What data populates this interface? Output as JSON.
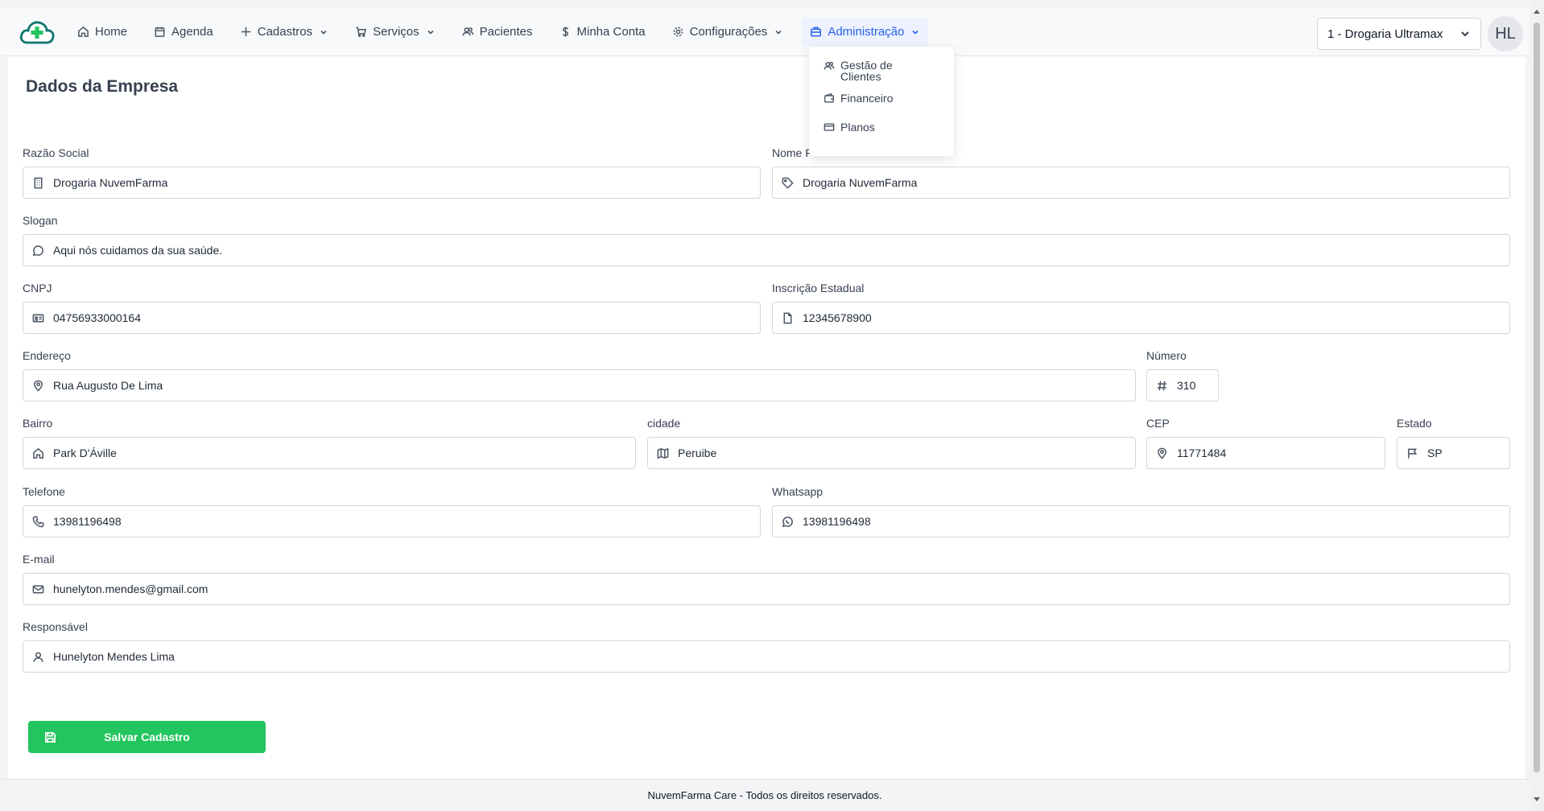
{
  "nav": {
    "home": "Home",
    "agenda": "Agenda",
    "cadastros": "Cadastros",
    "servicos": "Serviços",
    "pacientes": "Pacientes",
    "minha_conta": "Minha Conta",
    "configuracoes": "Configurações",
    "administracao": "Administração"
  },
  "admin_menu": {
    "gestao_clientes": "Gestão de Clientes",
    "financeiro": "Financeiro",
    "planos": "Planos"
  },
  "store_select": {
    "value": "1 - Drogaria Ultramax"
  },
  "avatar": {
    "initials": "HL"
  },
  "colors": {
    "primary": "#2563eb",
    "success": "#22c55e",
    "brand": "#0f766e"
  },
  "page": {
    "title": "Dados da Empresa"
  },
  "form": {
    "razao_social": {
      "label": "Razão Social",
      "value": "Drogaria NuvemFarma"
    },
    "nome_fantasia": {
      "label": "Nome F",
      "value": "Drogaria NuvemFarma"
    },
    "slogan": {
      "label": "Slogan",
      "value": "Aqui nós cuidamos da sua saúde."
    },
    "cnpj": {
      "label": "CNPJ",
      "value": "04756933000164"
    },
    "inscricao_estadual": {
      "label": "Inscrição Estadual",
      "value": "12345678900"
    },
    "endereco": {
      "label": "Endereço",
      "value": "Rua Augusto De Lima"
    },
    "numero": {
      "label": "Número",
      "value": "310"
    },
    "bairro": {
      "label": "Bairro",
      "value": "Park D'Áville"
    },
    "cidade": {
      "label": "cidade",
      "value": "Peruibe"
    },
    "cep": {
      "label": "CEP",
      "value": "11771484"
    },
    "estado": {
      "label": "Estado",
      "value": "SP"
    },
    "telefone": {
      "label": "Telefone",
      "value": "13981196498"
    },
    "whatsapp": {
      "label": "Whatsapp",
      "value": "13981196498"
    },
    "email": {
      "label": "E-mail",
      "value": "hunelyton.mendes@gmail.com"
    },
    "responsavel": {
      "label": "Responsável",
      "value": "Hunelyton Mendes Lima"
    }
  },
  "actions": {
    "save": "Salvar Cadastro"
  },
  "footer": {
    "text": "NuvemFarma Care - Todos os direitos reservados."
  }
}
